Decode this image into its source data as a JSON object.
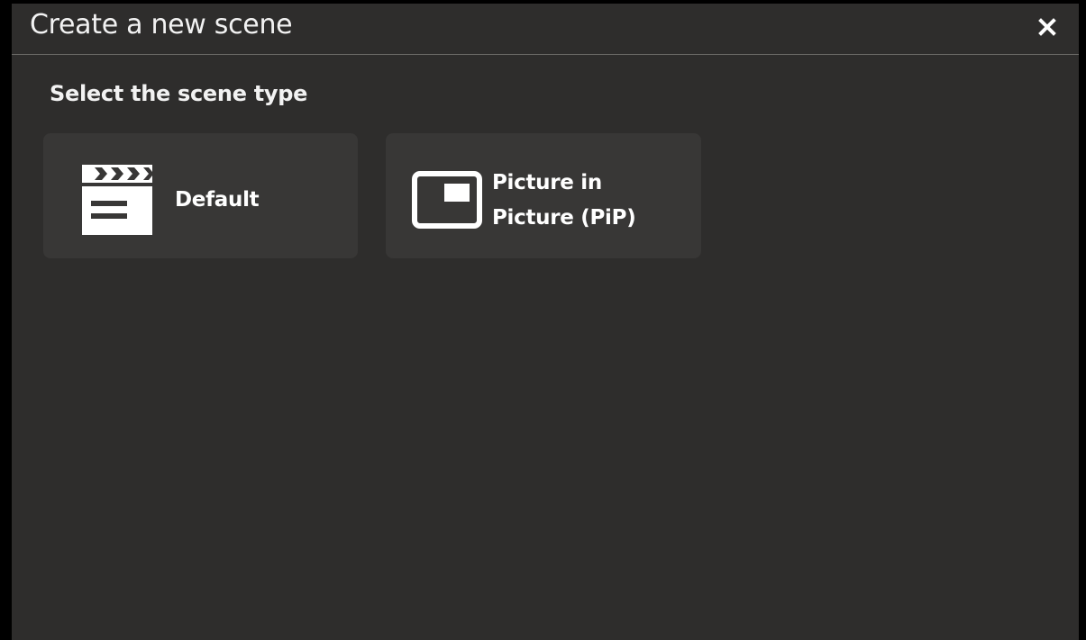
{
  "dialog": {
    "title": "Create a new scene",
    "close_icon": "close-icon"
  },
  "section": {
    "heading": "Select the scene type"
  },
  "scene_types": [
    {
      "label": "Default",
      "icon": "clapperboard-icon"
    },
    {
      "label_line1": "Picture in",
      "label_line2": "Picture (PiP)",
      "icon": "picture-in-picture-icon"
    }
  ],
  "colors": {
    "background": "#2e2d2c",
    "card": "#383736",
    "text": "#ffffff"
  }
}
